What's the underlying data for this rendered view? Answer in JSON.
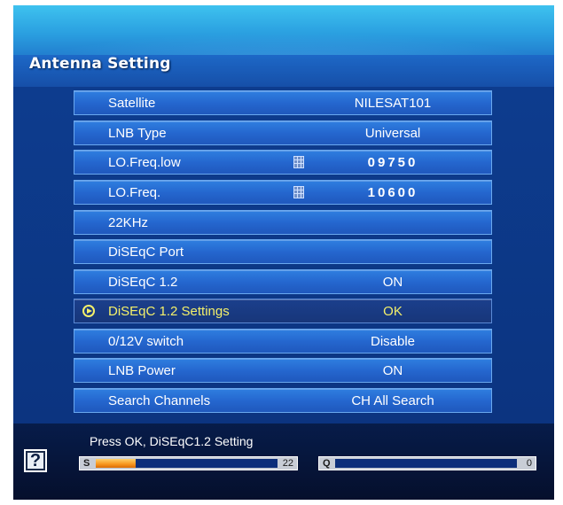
{
  "header": {
    "title": "Antenna Setting"
  },
  "rows": [
    {
      "label": "Satellite",
      "value": "NILESAT101"
    },
    {
      "label": "LNB Type",
      "value": "Universal"
    },
    {
      "label": "LO.Freq.low",
      "value": "09750",
      "icon": "keypad-icon"
    },
    {
      "label": "LO.Freq.",
      "value": "10600",
      "icon": "keypad-icon"
    },
    {
      "label": "22KHz",
      "value": ""
    },
    {
      "label": "DiSEqC Port",
      "value": ""
    },
    {
      "label": "DiSEqC 1.2",
      "value": "ON"
    },
    {
      "label": "DiSEqC 1.2 Settings",
      "value": "OK",
      "selected": true,
      "icon": "select-arrow-icon"
    },
    {
      "label": "0/12V switch",
      "value": "Disable"
    },
    {
      "label": "LNB Power",
      "value": "ON"
    },
    {
      "label": "Search Channels",
      "value": "CH All Search"
    }
  ],
  "footer": {
    "help_icon": "help-icon",
    "hint": "Press OK, DiSEqC1.2 Setting",
    "signal": {
      "label": "S",
      "value": "22",
      "level": 0.22
    },
    "quality": {
      "label": "Q",
      "value": "0",
      "level": 0
    }
  },
  "colors": {
    "row_bg": "#2567cf",
    "selected_text": "#f4f06a",
    "meter_fill": "#f7951e"
  }
}
